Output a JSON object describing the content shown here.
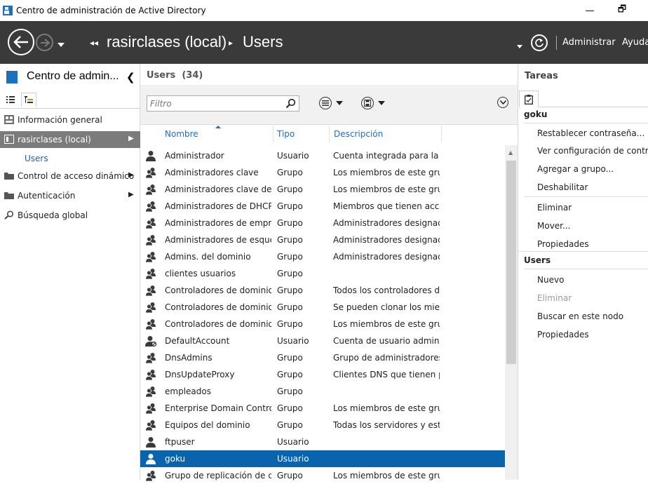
{
  "window": {
    "title": "Centro de administración de Active Directory",
    "minimize": "—",
    "maximize": "🗗"
  },
  "navbar": {
    "crumb_arrows": "◂◂",
    "breadcrumb": [
      "rasirclases (local)",
      "Users"
    ],
    "menu": [
      "Administrar",
      "Ayuda"
    ]
  },
  "leftpane": {
    "title": "Centro de admin...",
    "items": [
      {
        "label": "Información general",
        "icon": "overview-icon",
        "arrow": ""
      },
      {
        "label": "rasirclases (local)",
        "icon": "domain-icon",
        "arrow": "▶"
      },
      {
        "label": "Control de acceso dinámico",
        "icon": "folder-icon",
        "arrow": "▶"
      },
      {
        "label": "Autenticación",
        "icon": "folder-icon",
        "arrow": "▶"
      },
      {
        "label": "Búsqueda global",
        "icon": "search-icon",
        "arrow": ""
      }
    ],
    "sub_item": "Users"
  },
  "center": {
    "title": "Users",
    "count": "(34)",
    "filter_placeholder": "Filtro",
    "columns": [
      "Nombre",
      "Tipo",
      "Descripción"
    ],
    "rows": [
      {
        "name": "Administrador",
        "type": "Usuario",
        "desc": "Cuenta integrada para la a...",
        "icon": "user"
      },
      {
        "name": "Administradores clave",
        "type": "Grupo",
        "desc": "Los miembros de este gru...",
        "icon": "group"
      },
      {
        "name": "Administradores clave de l...",
        "type": "Grupo",
        "desc": "Los miembros de este gru...",
        "icon": "group"
      },
      {
        "name": "Administradores de DHCP",
        "type": "Grupo",
        "desc": "Miembros que tienen acce...",
        "icon": "group"
      },
      {
        "name": "Administradores de empre...",
        "type": "Grupo",
        "desc": "Administradores designad...",
        "icon": "group"
      },
      {
        "name": "Administradores de esque...",
        "type": "Grupo",
        "desc": "Administradores designad...",
        "icon": "group"
      },
      {
        "name": "Admins. del dominio",
        "type": "Grupo",
        "desc": "Administradores designad...",
        "icon": "group"
      },
      {
        "name": "clientes usuarios",
        "type": "Grupo",
        "desc": "",
        "icon": "group"
      },
      {
        "name": "Controladores de dominio",
        "type": "Grupo",
        "desc": "Todos los controladores d...",
        "icon": "group"
      },
      {
        "name": "Controladores de dominio...",
        "type": "Grupo",
        "desc": "Se pueden clonar los mie...",
        "icon": "group"
      },
      {
        "name": "Controladores de dominio...",
        "type": "Grupo",
        "desc": "Los miembros de este gru...",
        "icon": "group"
      },
      {
        "name": "DefaultAccount",
        "type": "Usuario",
        "desc": "Cuenta de usuario adminis...",
        "icon": "user-disabled"
      },
      {
        "name": "DnsAdmins",
        "type": "Grupo",
        "desc": "Grupo de administradores...",
        "icon": "group"
      },
      {
        "name": "DnsUpdateProxy",
        "type": "Grupo",
        "desc": "Clientes DNS que tienen p...",
        "icon": "group"
      },
      {
        "name": "empleados",
        "type": "Grupo",
        "desc": "",
        "icon": "group"
      },
      {
        "name": "Enterprise Domain Control...",
        "type": "Grupo",
        "desc": "Los miembros de este gru...",
        "icon": "group"
      },
      {
        "name": "Equipos del dominio",
        "type": "Grupo",
        "desc": "Todas los servidores y esta...",
        "icon": "group"
      },
      {
        "name": "ftpuser",
        "type": "Usuario",
        "desc": "",
        "icon": "user"
      },
      {
        "name": "goku",
        "type": "Usuario",
        "desc": "",
        "icon": "user"
      },
      {
        "name": "Grupo de replicación de c...",
        "type": "Grupo",
        "desc": "Los miembros de este gru...",
        "icon": "group"
      }
    ],
    "selected_row": 18
  },
  "tasks": {
    "title": "Tareas",
    "section1": "goku",
    "section1_items": [
      "Restablecer contraseña...",
      "Ver configuración de contrase",
      "Agregar a grupo...",
      "Deshabilitar",
      "Eliminar",
      "Mover...",
      "Propiedades"
    ],
    "section2": "Users",
    "section2_items": [
      "Nuevo",
      "Eliminar",
      "Buscar en este nodo",
      "Propiedades"
    ]
  },
  "colors": {
    "navbar": "#3a3a3a",
    "selection": "#0a63ad",
    "nav_selected": "#7b7b7b",
    "link": "#2a6cb8"
  }
}
